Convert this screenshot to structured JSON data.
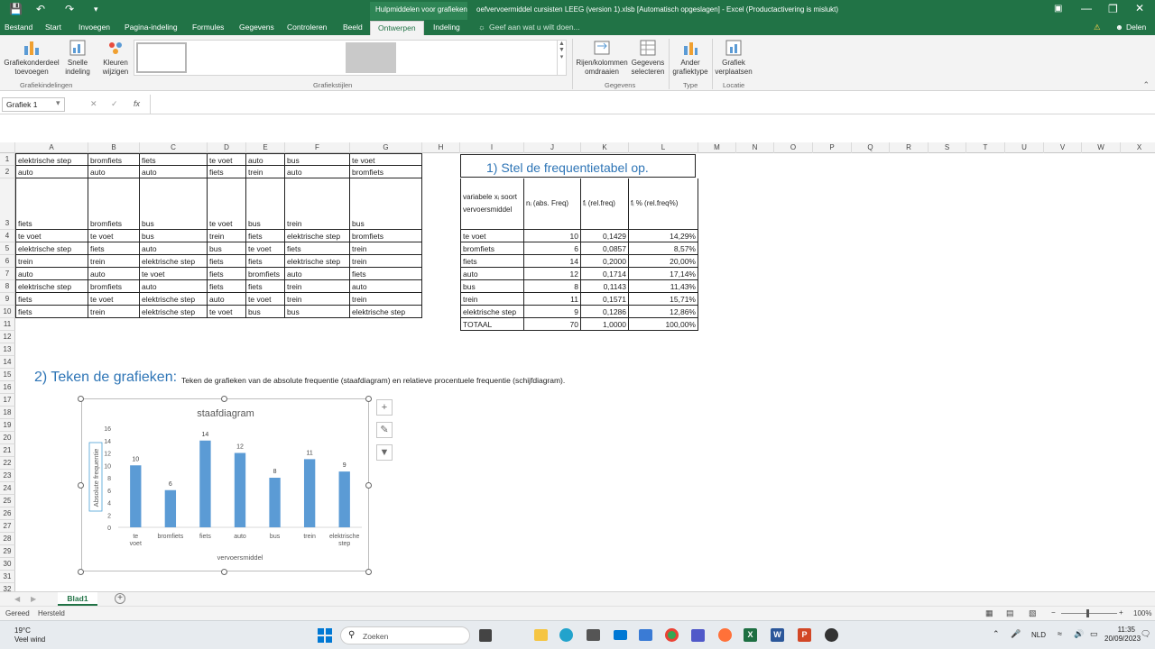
{
  "window": {
    "title": "oefvervoermiddel cursisten LEEG (version 1).xlsb [Automatisch opgeslagen] - Excel (Productactivering is mislukt)",
    "context_label": "Hulpmiddelen voor grafieken",
    "share_label": "Delen"
  },
  "ribbon": {
    "tabs": [
      "Bestand",
      "Start",
      "Invoegen",
      "Pagina-indeling",
      "Formules",
      "Gegevens",
      "Controleren",
      "Beeld",
      "Ontwerpen",
      "Indeling"
    ],
    "active_tab": "Ontwerpen",
    "search_placeholder": "Geef aan wat u wilt doen...",
    "buttons": {
      "add_element": "Grafiekonderdeel toevoegen",
      "quick_layout": "Snelle indeling",
      "colors": "Kleuren wijzigen",
      "switch_rowcol": "Rijen/kolommen omdraaien",
      "select_data": "Gegevens selecteren",
      "change_type": "Ander grafiektype",
      "move_chart": "Grafiek verplaatsen"
    },
    "groups": {
      "layouts": "Grafiekindelingen",
      "styles": "Grafiekstijlen",
      "data": "Gegevens",
      "type": "Type",
      "location": "Locatie"
    }
  },
  "formula_bar": {
    "name_box": "Grafiek 1",
    "fx": "fx"
  },
  "columns": [
    "A",
    "B",
    "C",
    "D",
    "E",
    "F",
    "G",
    "H",
    "I",
    "J",
    "K",
    "L",
    "M",
    "N",
    "O",
    "P",
    "Q",
    "R",
    "S",
    "T",
    "U",
    "V",
    "W",
    "X"
  ],
  "rows": [
    "1",
    "2",
    "3",
    "4",
    "5",
    "6",
    "7",
    "8",
    "9",
    "10",
    "11",
    "12",
    "13",
    "14",
    "15",
    "16",
    "17",
    "18",
    "19",
    "20",
    "21",
    "22",
    "23",
    "24",
    "25",
    "26",
    "27",
    "28",
    "29",
    "30",
    "31",
    "32"
  ],
  "data_table": [
    [
      "elektrische step",
      "bromfiets",
      "fiets",
      "te voet",
      "auto",
      "bus",
      "te voet"
    ],
    [
      "auto",
      "auto",
      "auto",
      "fiets",
      "trein",
      "auto",
      "bromfiets"
    ],
    [
      "fiets",
      "bromfiets",
      "bus",
      "te voet",
      "bus",
      "trein",
      "bus"
    ],
    [
      "te voet",
      "te voet",
      "bus",
      "trein",
      "fiets",
      "elektrische step",
      "bromfiets"
    ],
    [
      "elektrische step",
      "fiets",
      "auto",
      "bus",
      "te voet",
      "fiets",
      "trein"
    ],
    [
      "trein",
      "trein",
      "elektrische step",
      "fiets",
      "fiets",
      "elektrische step",
      "trein"
    ],
    [
      "auto",
      "auto",
      "te voet",
      "fiets",
      "bromfiets",
      "auto",
      "fiets"
    ],
    [
      "elektrische step",
      "bromfiets",
      "auto",
      "fiets",
      "fiets",
      "trein",
      "auto"
    ],
    [
      "fiets",
      "te voet",
      "elektrische step",
      "auto",
      "te voet",
      "trein",
      "trein"
    ],
    [
      "fiets",
      "trein",
      "elektrische step",
      "te voet",
      "bus",
      "bus",
      "elektrische step"
    ]
  ],
  "freq": {
    "heading": "1) Stel de frequentietabel op.",
    "header": [
      "variabele xᵢ soort vervoersmiddel",
      "nᵢ (abs. Freq)",
      "fᵢ (rel.freq)",
      "fᵢ % (rel.freq%)"
    ],
    "rows": [
      [
        "te voet",
        "10",
        "0,1429",
        "14,29%"
      ],
      [
        "bromfiets",
        "6",
        "0,0857",
        "8,57%"
      ],
      [
        "fiets",
        "14",
        "0,2000",
        "20,00%"
      ],
      [
        "auto",
        "12",
        "0,1714",
        "17,14%"
      ],
      [
        "bus",
        "8",
        "0,1143",
        "11,43%"
      ],
      [
        "trein",
        "11",
        "0,1571",
        "15,71%"
      ],
      [
        "elektrische step",
        "9",
        "0,1286",
        "12,86%"
      ],
      [
        "TOTAAL",
        "70",
        "1,0000",
        "100,00%"
      ]
    ]
  },
  "section2": {
    "heading": "2) Teken de grafieken:",
    "text": "Teken de grafieken van de absolute frequentie (staafdiagram) en relatieve procentuele frequentie (schijfdiagram)."
  },
  "chart_data": {
    "type": "bar",
    "title": "staafdiagram",
    "categories": [
      "te voet",
      "bromfiets",
      "fiets",
      "auto",
      "bus",
      "trein",
      "elektrische step"
    ],
    "values": [
      10,
      6,
      14,
      12,
      8,
      11,
      9
    ],
    "xlabel": "vervoersmiddel",
    "ylabel": "Absolute frequentie",
    "ylim": [
      0,
      16
    ],
    "yticks": [
      0,
      2,
      4,
      6,
      8,
      10,
      12,
      14,
      16
    ],
    "color": "#5b9bd5",
    "grid": false,
    "data_labels": true
  },
  "sheet_tab": "Blad1",
  "status": {
    "ready": "Gereed",
    "recovered": "Hersteld",
    "zoom": "100%"
  },
  "taskbar": {
    "weather_temp": "19°C",
    "weather_desc": "Veel wind",
    "search": "Zoeken",
    "lang": "NLD",
    "time": "11:35",
    "date": "20/09/2023"
  }
}
